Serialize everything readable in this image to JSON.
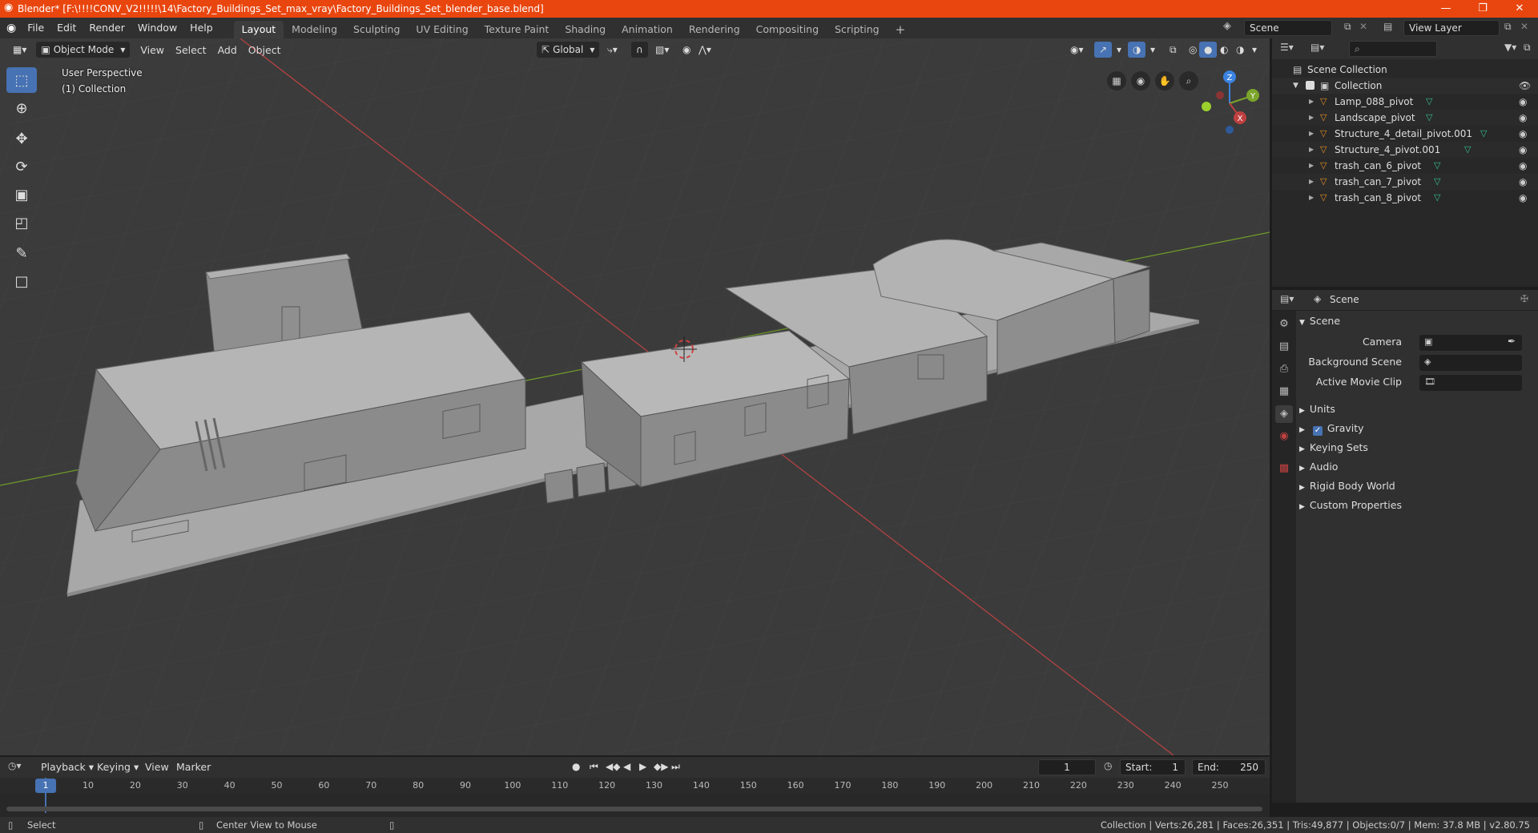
{
  "titlebar": {
    "title": "Blender* [F:\\!!!!CONV_V2!!!!!\\14\\Factory_Buildings_Set_max_vray\\Factory_Buildings_Set_blender_base.blend]",
    "minimize": "—",
    "restore": "❐",
    "close": "✕"
  },
  "menu": [
    "File",
    "Edit",
    "Render",
    "Window",
    "Help"
  ],
  "workspaces": [
    "Layout",
    "Modeling",
    "Sculpting",
    "UV Editing",
    "Texture Paint",
    "Shading",
    "Animation",
    "Rendering",
    "Compositing",
    "Scripting"
  ],
  "workspace_add": "+",
  "scene_field": "Scene",
  "view_layer_field": "View Layer",
  "viewport": {
    "mode": "Object Mode",
    "menus": [
      "View",
      "Select",
      "Add",
      "Object"
    ],
    "orientation": "Global",
    "perspective_label": "User Perspective",
    "collection_label": "(1) Collection",
    "gizmo": {
      "x": "X",
      "y": "Y",
      "z": "Z"
    }
  },
  "outliner": {
    "root": "Scene Collection",
    "collection": "Collection",
    "items": [
      "Lamp_088_pivot",
      "Landscape_pivot",
      "Structure_4_detail_pivot.001",
      "Structure_4_pivot.001",
      "trash_can_6_pivot",
      "trash_can_7_pivot",
      "trash_can_8_pivot"
    ]
  },
  "properties": {
    "header": "Scene",
    "panel": "Scene",
    "camera_label": "Camera",
    "background_scene_label": "Background Scene",
    "active_movie_clip_label": "Active Movie Clip",
    "sections": [
      "Units",
      "Gravity",
      "Keying Sets",
      "Audio",
      "Rigid Body World",
      "Custom Properties"
    ],
    "gravity_checked": true
  },
  "timeline": {
    "menus": [
      "Playback",
      "Keying",
      "View",
      "Marker"
    ],
    "current_frame": "1",
    "start_label": "Start:",
    "start_value": "1",
    "end_label": "End:",
    "end_value": "250",
    "ticks": [
      "1",
      "10",
      "20",
      "30",
      "40",
      "50",
      "60",
      "70",
      "80",
      "90",
      "100",
      "110",
      "120",
      "130",
      "140",
      "150",
      "160",
      "170",
      "180",
      "190",
      "200",
      "210",
      "220",
      "230",
      "240",
      "250"
    ]
  },
  "statusbar": {
    "select": "Select",
    "center_view": "Center View to Mouse",
    "stats": "Collection | Verts:26,281 | Faces:26,351 | Tris:49,877 | Objects:0/7 | Mem: 37.8 MB | v2.80.75"
  },
  "colors": {
    "titlebar": "#e9460f",
    "accent": "#4772b3",
    "x_axis": "#c04040",
    "y_axis": "#7ca52c",
    "z_axis": "#3b82e0",
    "object_icon": "#e8902a",
    "mesh_icon": "#35c08e"
  }
}
